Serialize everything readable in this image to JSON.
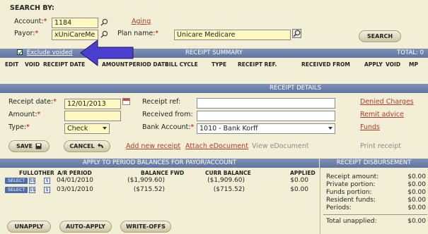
{
  "search": {
    "heading": "SEARCH BY:",
    "account_label": "Account:",
    "account_value": "1184",
    "payor_label": "Payor:",
    "payor_value": "xUniCareMe",
    "aging_link": "Aging",
    "plan_label": "Plan name:",
    "plan_value": "Unicare Medicare",
    "search_button": "SEARCH",
    "required_mark": "*"
  },
  "receipt_summary": {
    "exclude_voided_label": "Exclude voided",
    "exclude_voided_checked": true,
    "title": "RECEIPT SUMMARY",
    "total_label": "TOTAL: 0",
    "columns": [
      "EDIT",
      "VOID",
      "RECEIPT DATE",
      "AMOUNT",
      "PERIOD DATE",
      "BILL CYCLE",
      "TYPE",
      "RECEIPT REF.",
      "RECEIVED FROM",
      "APPLY",
      "VOID",
      "MP"
    ]
  },
  "receipt_details": {
    "title": "RECEIPT DETAILS",
    "receipt_date_label": "Receipt date:",
    "receipt_date_value": "12/01/2013",
    "amount_label": "Amount:",
    "amount_value": "",
    "type_label": "Type:",
    "type_value": "Check",
    "receipt_ref_label": "Receipt ref:",
    "receipt_ref_value": "",
    "received_from_label": "Received from:",
    "received_from_value": "",
    "bank_account_label": "Bank Account:",
    "bank_account_value": "1010 - Bank Korff",
    "denied_charges_link": "Denied Charges",
    "remit_advice_link": "Remit advice",
    "funds_link": "Funds",
    "required_mark": "*"
  },
  "actions": {
    "save": "SAVE",
    "cancel": "CANCEL",
    "add_new_receipt": "Add new receipt",
    "attach_edocument": "Attach eDocument",
    "view_edocument": "View eDocument",
    "print_receipt": "Print receipt"
  },
  "apply_section": {
    "title": "APPLY TO PERIOD BALANCES FOR PAYOR/ACCOUNT",
    "columns": {
      "full": "FULL",
      "other": "OTHER",
      "ar_period": "A/R PERIOD",
      "balance_fwd": "BALANCE FWD",
      "curr_balance": "CURR BALANCE",
      "applied": "APPLIED"
    },
    "select_label": "SELECT",
    "full_glyph": "$$",
    "other_glyph": "$",
    "rows": [
      {
        "period": "04/01/2010",
        "balance_fwd": "($1,909.60)",
        "curr_balance": "($1,909.60)",
        "applied": "$0.00"
      },
      {
        "period": "03/01/2010",
        "balance_fwd": "($715.52)",
        "curr_balance": "($715.52)",
        "applied": "$0.00"
      }
    ]
  },
  "disbursement": {
    "title": "RECEIPT DISBURSEMENT",
    "rows": [
      {
        "label": "Receipt amount:",
        "value": "$0.00"
      },
      {
        "label": "Private portion:",
        "value": "$0.00"
      },
      {
        "label": "Funds portion:",
        "value": "$0.00"
      },
      {
        "label": "Resident funds:",
        "value": "$0.00"
      },
      {
        "label": "Periods:",
        "value": "$0.00"
      }
    ],
    "total_unapplied_label": "Total unapplied:",
    "total_unapplied_value": "$0.00"
  },
  "bottom_buttons": {
    "unapply": "UNAPPLY",
    "auto_apply": "AUTO-APPLY",
    "write_offs": "WRITE-OFFS"
  },
  "colors": {
    "background": "#f3efd6",
    "header_bar": "#6c7ea6",
    "required_field": "#fff8c0",
    "link": "#b23a2b",
    "arrow": "#4a3fd0"
  }
}
